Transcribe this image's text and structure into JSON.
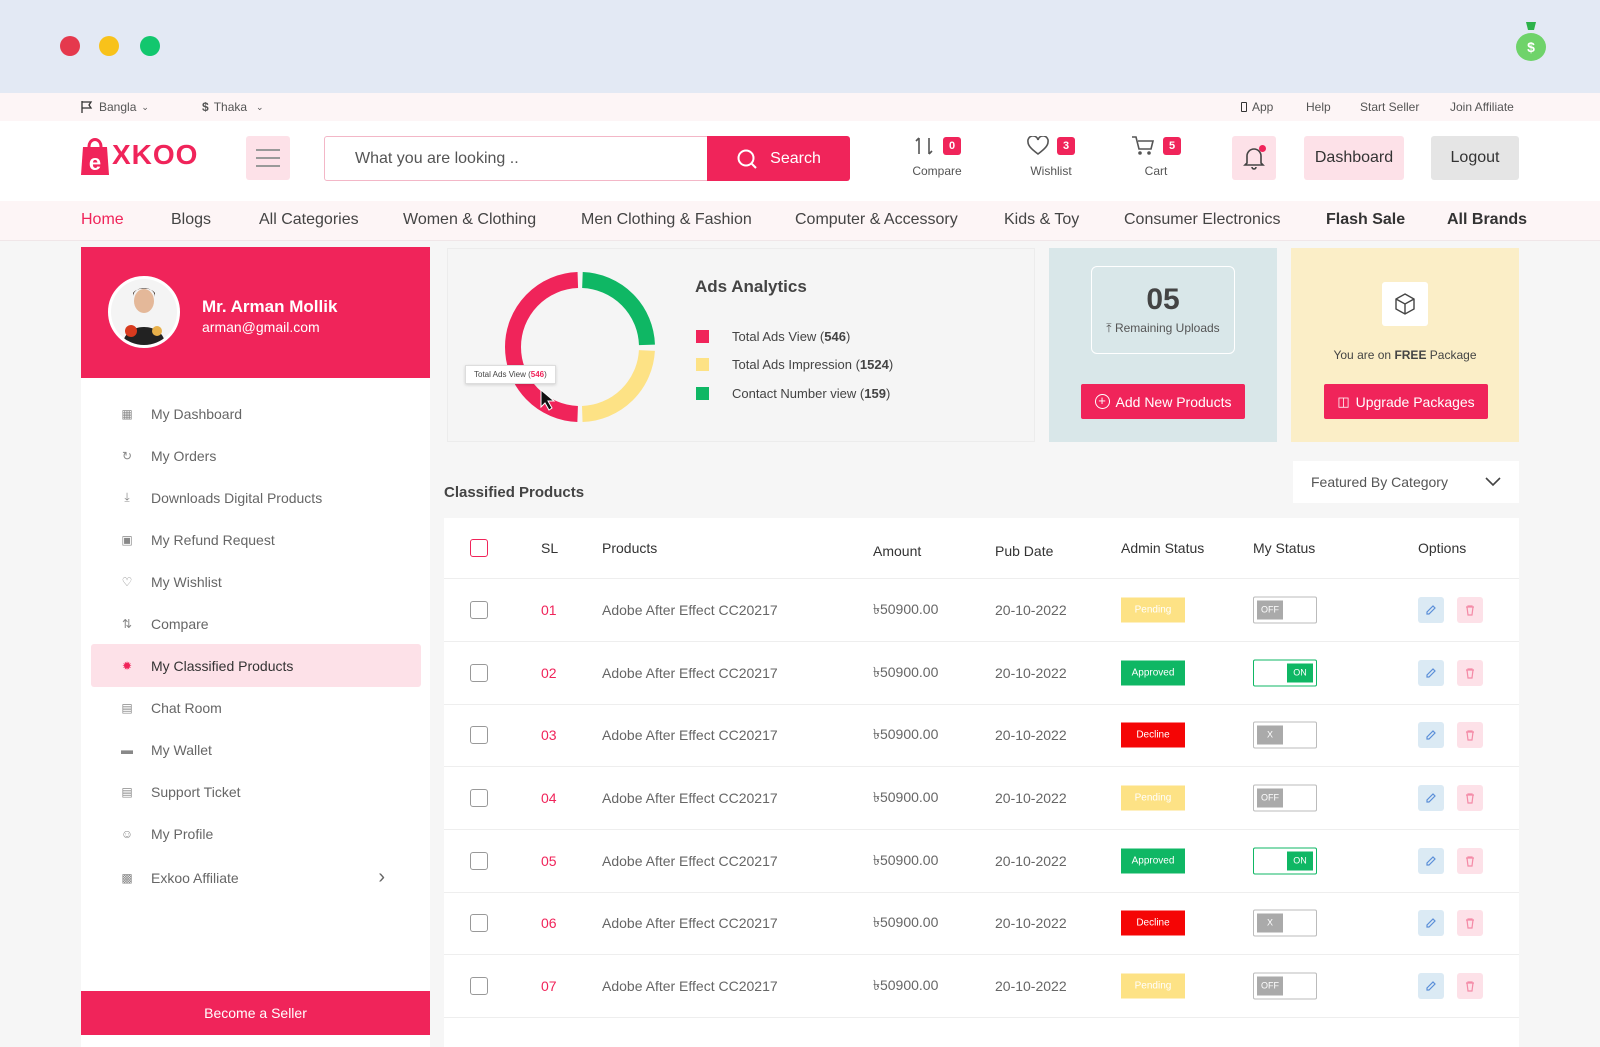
{
  "topbar": {
    "language": "Bangla",
    "currency": "Thaka",
    "links": [
      "App",
      "Help",
      "Start Seller",
      "Join Affiliate"
    ]
  },
  "header": {
    "logo_text": "XKOO",
    "search_placeholder": "What you are looking ..",
    "search_label": "Search",
    "compare": {
      "label": "Compare",
      "count": "0"
    },
    "wishlist": {
      "label": "Wishlist",
      "count": "3"
    },
    "cart": {
      "label": "Cart",
      "count": "5"
    },
    "dashboard_label": "Dashboard",
    "logout_label": "Logout"
  },
  "nav": [
    "Home",
    "Blogs",
    "All Categories",
    "Women & Clothing",
    "Men Clothing & Fashion",
    "Computer & Accessory",
    "Kids & Toy",
    "Consumer Electronics",
    "Flash Sale",
    "All Brands"
  ],
  "profile": {
    "name": "Mr. Arman Mollik",
    "email": "arman@gmail.com"
  },
  "sidebar": {
    "items": [
      {
        "label": "My Dashboard",
        "icon": "dashboard-icon"
      },
      {
        "label": "My Orders",
        "icon": "history-icon"
      },
      {
        "label": "Downloads Digital Products",
        "icon": "download-icon"
      },
      {
        "label": "My Refund Request",
        "icon": "refund-icon"
      },
      {
        "label": "My Wishlist",
        "icon": "heart-icon"
      },
      {
        "label": "Compare",
        "icon": "compare-icon"
      },
      {
        "label": "My Classified Products",
        "icon": "classified-icon"
      },
      {
        "label": "Chat Room",
        "icon": "chat-icon"
      },
      {
        "label": "My Wallet",
        "icon": "wallet-icon"
      },
      {
        "label": "Support Ticket",
        "icon": "ticket-icon"
      },
      {
        "label": "My Profile",
        "icon": "user-icon"
      },
      {
        "label": "Exkoo Affiliate",
        "icon": "affiliate-icon"
      }
    ],
    "active_index": 6,
    "become_seller_label": "Become a Seller"
  },
  "ads": {
    "title": "Ads Analytics",
    "tooltip_label": "Total Ads View",
    "tooltip_value": "546",
    "legend": [
      {
        "label": "Total Ads View",
        "value": "546",
        "color": "#f0245a"
      },
      {
        "label": "Total Ads Impression",
        "value": "1524",
        "color": "#fde285"
      },
      {
        "label": "Contact Number view",
        "value": "159",
        "color": "#0fb764"
      }
    ]
  },
  "uploads": {
    "count": "05",
    "label": "Remaining Uploads",
    "button": "Add New Products"
  },
  "package": {
    "text_before": "You are on ",
    "plan": "FREE",
    "text_after": " Package",
    "button": "Upgrade Packages"
  },
  "classified": {
    "title": "Classified Products",
    "filter_label": "Featured By Category",
    "columns": [
      "SL",
      "Products",
      "Amount",
      "Pub Date",
      "Admin Status",
      "My Status",
      "Options"
    ],
    "rows": [
      {
        "sl": "01",
        "product": "Adobe After Effect CC20217",
        "amount": "৳50900.00",
        "date": "20-10-2022",
        "status": "Pending",
        "toggle": "OFF"
      },
      {
        "sl": "02",
        "product": "Adobe After Effect CC20217",
        "amount": "৳50900.00",
        "date": "20-10-2022",
        "status": "Approved",
        "toggle": "ON"
      },
      {
        "sl": "03",
        "product": "Adobe After Effect CC20217",
        "amount": "৳50900.00",
        "date": "20-10-2022",
        "status": "Decline",
        "toggle": "X"
      },
      {
        "sl": "04",
        "product": "Adobe After Effect CC20217",
        "amount": "৳50900.00",
        "date": "20-10-2022",
        "status": "Pending",
        "toggle": "OFF"
      },
      {
        "sl": "05",
        "product": "Adobe After Effect CC20217",
        "amount": "৳50900.00",
        "date": "20-10-2022",
        "status": "Approved",
        "toggle": "ON"
      },
      {
        "sl": "06",
        "product": "Adobe After Effect CC20217",
        "amount": "৳50900.00",
        "date": "20-10-2022",
        "status": "Decline",
        "toggle": "X"
      },
      {
        "sl": "07",
        "product": "Adobe After Effect CC20217",
        "amount": "৳50900.00",
        "date": "20-10-2022",
        "status": "Pending",
        "toggle": "OFF"
      }
    ]
  }
}
